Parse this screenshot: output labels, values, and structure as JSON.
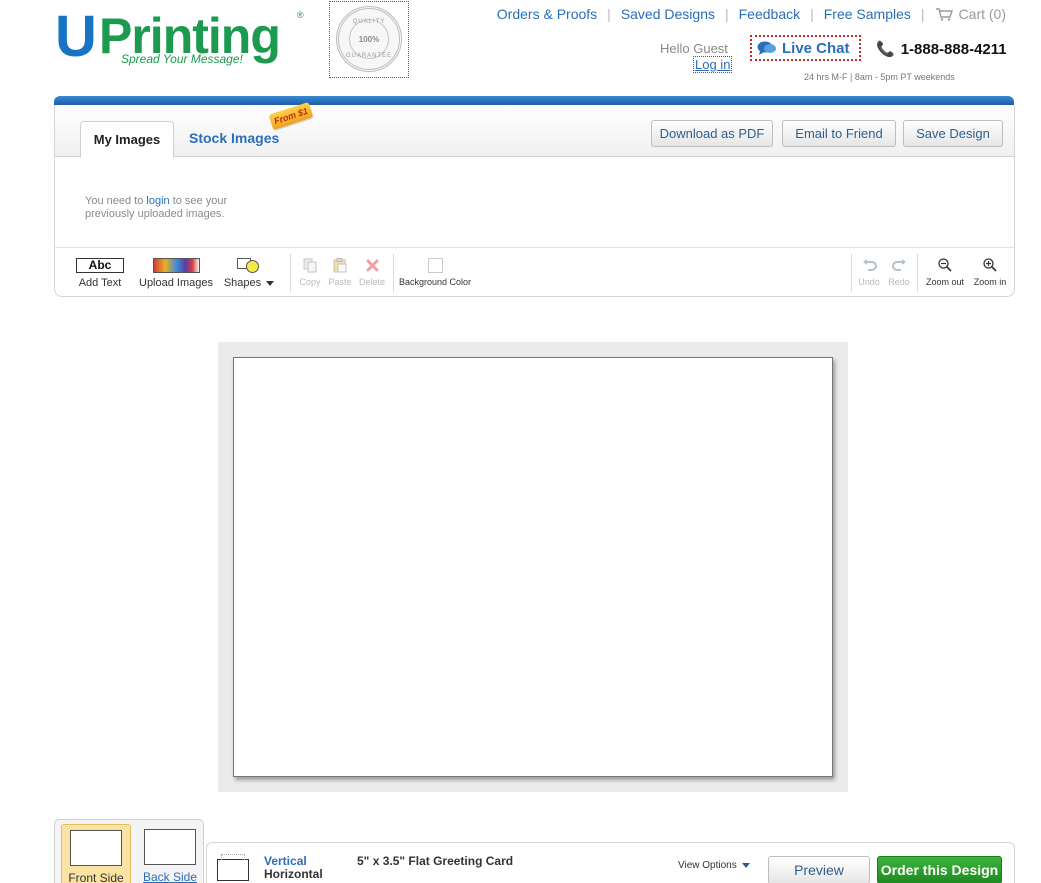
{
  "brand": {
    "logo_u": "U",
    "logo_printing": "Printing",
    "logo_reg": "®",
    "tagline": "Spread Your Message!",
    "primary_color": "#1673c6",
    "secondary_color": "#1b9a50"
  },
  "seal": {
    "top": "QUALITY",
    "middle": "100%",
    "bottom": "GUARANTEE"
  },
  "topnav": {
    "items": [
      "Orders & Proofs",
      "Saved Designs",
      "Feedback",
      "Free Samples"
    ],
    "cart_label": "Cart (0)"
  },
  "account": {
    "hello": "Hello Guest",
    "login": "Log in",
    "live_chat": "Live Chat",
    "phone": "1-888-888-4211",
    "hours": "24 hrs M-F | 8am - 5pm PT weekends"
  },
  "tabs": {
    "my_images": "My Images",
    "stock_images": "Stock Images",
    "stock_badge": "From $1"
  },
  "header_buttons": {
    "download_pdf": "Download as PDF",
    "email_friend": "Email to Friend",
    "save_design": "Save Design"
  },
  "login_note": {
    "before": "You need to ",
    "link": "login",
    "after": " to see your previously uploaded images."
  },
  "toolbar": {
    "add_text_icon": "Abc",
    "add_text": "Add Text",
    "upload_images": "Upload Images",
    "shapes": "Shapes",
    "copy": "Copy",
    "paste": "Paste",
    "delete": "Delete",
    "background_color": "Background Color",
    "undo": "Undo",
    "redo": "Redo",
    "zoom_out": "Zoom out",
    "zoom_in": "Zoom in"
  },
  "sides": {
    "front": "Front Side",
    "back": "Back Side"
  },
  "bottom": {
    "vertical": "Vertical",
    "horizontal": "Horizontal",
    "product": "5\" x 3.5\" Flat Greeting Card",
    "view_options": "View Options",
    "preview": "Preview",
    "order": "Order this Design"
  }
}
